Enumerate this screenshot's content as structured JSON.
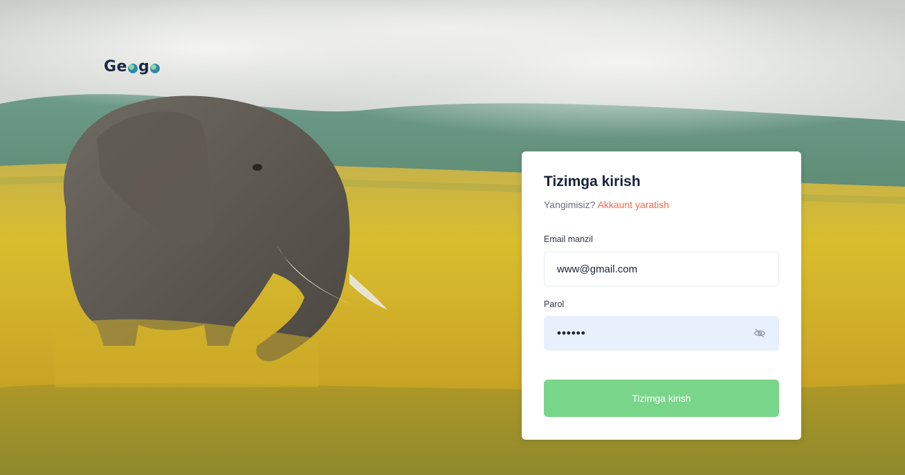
{
  "brand": {
    "logo_left": "Ge",
    "logo_mid": "g",
    "logo_right": ""
  },
  "login": {
    "title": "Tizimga kirish",
    "signup_prompt": "Yangimisiz?",
    "signup_link": "Akkaunt yaratish",
    "email_label": "Email manzil",
    "email_value": "www@gmail.com",
    "password_label": "Parol",
    "password_value": "••••••",
    "password_visibility_icon": "eye-off-icon",
    "submit_label": "Tizimga kirish"
  },
  "colors": {
    "accent_link": "#f06a4d",
    "submit_button": "#79d58a",
    "title_text": "#16213a",
    "password_field_bg": "#e8f0fd"
  }
}
